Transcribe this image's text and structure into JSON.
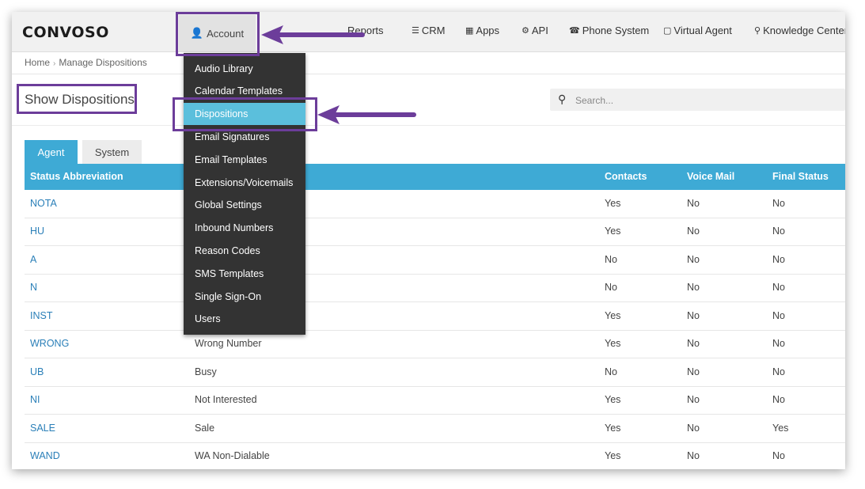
{
  "logo": "CONVOSO",
  "nav": {
    "account": "Account",
    "reports": "Reports",
    "crm": "CRM",
    "apps": "Apps",
    "api": "API",
    "phone_system": "Phone System",
    "virtual_agent": "Virtual Agent",
    "knowledge_center": "Knowledge Center"
  },
  "breadcrumb": {
    "home": "Home",
    "current": "Manage Dispositions"
  },
  "page_title": "Show Dispositions",
  "search": {
    "placeholder": "Search..."
  },
  "tabs": [
    {
      "label": "Agent",
      "active": true
    },
    {
      "label": "System",
      "active": false
    }
  ],
  "table": {
    "headers": [
      "Status Abbreviation",
      "",
      "Contacts",
      "Voice Mail",
      "Final Status"
    ],
    "rows": [
      {
        "abbr": "NOTA",
        "desc": "",
        "contacts": "Yes",
        "voicemail": "No",
        "final": "No"
      },
      {
        "abbr": "HU",
        "desc": "",
        "contacts": "Yes",
        "voicemail": "No",
        "final": "No"
      },
      {
        "abbr": "A",
        "desc": "",
        "contacts": "No",
        "voicemail": "No",
        "final": "No"
      },
      {
        "abbr": "N",
        "desc": "",
        "contacts": "No",
        "voicemail": "No",
        "final": "No"
      },
      {
        "abbr": "INST",
        "desc": "",
        "contacts": "Yes",
        "voicemail": "No",
        "final": "No"
      },
      {
        "abbr": "WRONG",
        "desc": "Wrong Number",
        "contacts": "Yes",
        "voicemail": "No",
        "final": "No"
      },
      {
        "abbr": "UB",
        "desc": "Busy",
        "contacts": "No",
        "voicemail": "No",
        "final": "No"
      },
      {
        "abbr": "NI",
        "desc": "Not Interested",
        "contacts": "Yes",
        "voicemail": "No",
        "final": "No"
      },
      {
        "abbr": "SALE",
        "desc": "Sale",
        "contacts": "Yes",
        "voicemail": "No",
        "final": "Yes"
      },
      {
        "abbr": "WAND",
        "desc": "WA Non-Dialable",
        "contacts": "Yes",
        "voicemail": "No",
        "final": "No"
      }
    ]
  },
  "account_menu": {
    "items": [
      "Audio Library",
      "Calendar Templates",
      "Dispositions",
      "Email Signatures",
      "Email Templates",
      "Extensions/Voicemails",
      "Global Settings",
      "Inbound Numbers",
      "Reason Codes",
      "SMS Templates",
      "Single Sign-On",
      "Users"
    ],
    "active": "Dispositions"
  },
  "colors": {
    "accent": "#3eaad5",
    "menu_bg": "#333333",
    "menu_active": "#5bbfdc",
    "annotation": "#6c3d9a",
    "link": "#2a7fb8"
  }
}
